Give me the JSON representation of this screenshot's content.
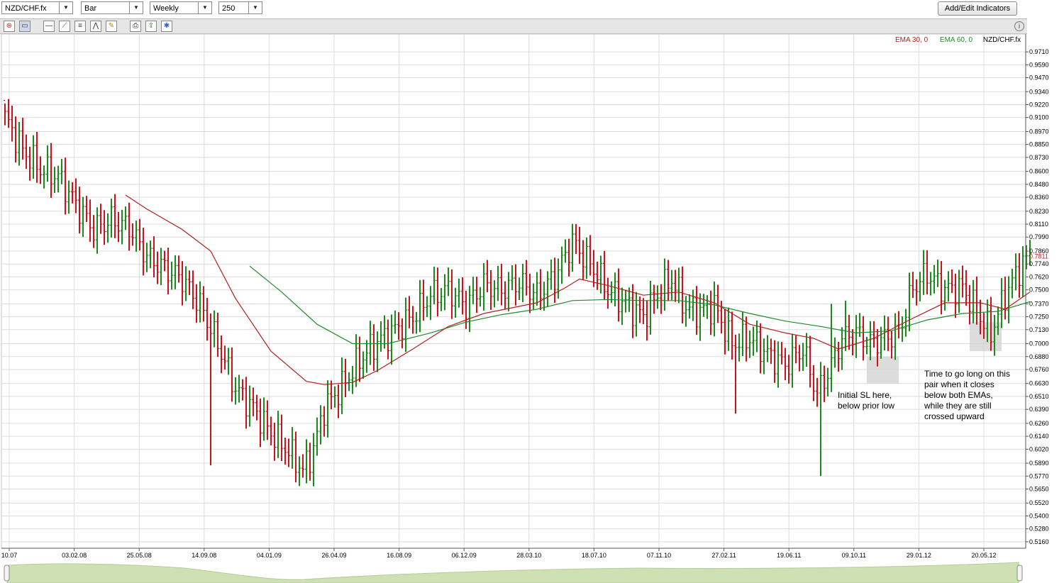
{
  "toolbar_top": {
    "symbol": "NZD/CHF.fx",
    "chart_type": "Bar",
    "period": "Weekly",
    "bars": "250",
    "add_indicators": "Add/Edit Indicators"
  },
  "toolbar_icons": [
    "crosshair-icon",
    "chart-style-icon",
    "horizontal-line-icon",
    "trend-line-icon",
    "fibonacci-icon",
    "pattern-icon",
    "eraser-icon",
    "print-icon",
    "export-icon",
    "settings-icon"
  ],
  "colors": {
    "up": "#1a8a1a",
    "down": "#d0101a",
    "ema30": "#b01e1e",
    "ema60": "#1f8a2a",
    "grid": "#dcdcdc"
  },
  "legend": {
    "ema30": "EMA 30, 0",
    "ema60": "EMA 60, 0",
    "symbol": "NZD/CHF.fx"
  },
  "annotations": {
    "sl": [
      "Initial SL here,",
      "below prior low"
    ],
    "entry": [
      "Time to go long on this",
      "pair when it closes",
      "below both EMAs,",
      "while they are still",
      "crossed upward"
    ]
  },
  "chart_data": {
    "type": "ohlc",
    "symbol": "NZD/CHF.fx",
    "timeframe": "Weekly",
    "current_price": "0.7811",
    "ylim": [
      0.51,
      0.977
    ],
    "y_ticks": [
      "0.9710",
      "0.9590",
      "0.9470",
      "0.9340",
      "0.9220",
      "0.9100",
      "0.8970",
      "0.8850",
      "0.8730",
      "0.8600",
      "0.8480",
      "0.8360",
      "0.8230",
      "0.8110",
      "0.7990",
      "0.7860",
      "0.7740",
      "0.7620",
      "0.7500",
      "0.7370",
      "0.7250",
      "0.7130",
      "0.7000",
      "0.6880",
      "0.6760",
      "0.6630",
      "0.6510",
      "0.6390",
      "0.6260",
      "0.6140",
      "0.6020",
      "0.5890",
      "0.5770",
      "0.5650",
      "0.5520",
      "0.5400",
      "0.5280",
      "0.5160"
    ],
    "x_ticks": [
      "10.07",
      "03.02.08",
      "25.05.08",
      "14.09.08",
      "04.01.09",
      "26.04.09",
      "16.08.09",
      "06.12.09",
      "28.03.10",
      "18.07.10",
      "07.11.10",
      "27.02.11",
      "19.06.11",
      "09.10.11",
      "29.01.12",
      "20.05.12"
    ],
    "anchor_closes": [
      [
        0,
        0.91
      ],
      [
        5,
        0.88
      ],
      [
        10,
        0.862
      ],
      [
        15,
        0.855
      ],
      [
        20,
        0.83
      ],
      [
        25,
        0.806
      ],
      [
        30,
        0.815
      ],
      [
        35,
        0.808
      ],
      [
        40,
        0.781
      ],
      [
        45,
        0.77
      ],
      [
        50,
        0.76
      ],
      [
        55,
        0.736
      ],
      [
        60,
        0.7
      ],
      [
        65,
        0.658
      ],
      [
        70,
        0.64
      ],
      [
        75,
        0.617
      ],
      [
        80,
        0.6
      ],
      [
        84,
        0.582
      ],
      [
        87,
        0.602
      ],
      [
        90,
        0.64
      ],
      [
        95,
        0.66
      ],
      [
        100,
        0.685
      ],
      [
        105,
        0.702
      ],
      [
        110,
        0.713
      ],
      [
        115,
        0.725
      ],
      [
        120,
        0.745
      ],
      [
        125,
        0.75
      ],
      [
        130,
        0.735
      ],
      [
        135,
        0.755
      ],
      [
        140,
        0.75
      ],
      [
        145,
        0.757
      ],
      [
        150,
        0.745
      ],
      [
        155,
        0.762
      ],
      [
        160,
        0.795
      ],
      [
        163,
        0.782
      ],
      [
        166,
        0.77
      ],
      [
        170,
        0.75
      ],
      [
        175,
        0.737
      ],
      [
        180,
        0.725
      ],
      [
        185,
        0.75
      ],
      [
        188,
        0.76
      ],
      [
        192,
        0.733
      ],
      [
        196,
        0.73
      ],
      [
        200,
        0.735
      ],
      [
        205,
        0.7
      ],
      [
        210,
        0.705
      ],
      [
        215,
        0.69
      ],
      [
        220,
        0.68
      ],
      [
        225,
        0.695
      ],
      [
        229,
        0.653
      ],
      [
        233,
        0.68
      ],
      [
        236,
        0.705
      ],
      [
        240,
        0.71
      ],
      [
        244,
        0.7
      ],
      [
        248,
        0.705
      ],
      [
        252,
        0.71
      ],
      [
        256,
        0.752
      ],
      [
        260,
        0.765
      ],
      [
        265,
        0.75
      ],
      [
        270,
        0.752
      ],
      [
        275,
        0.725
      ],
      [
        278,
        0.71
      ],
      [
        282,
        0.745
      ],
      [
        286,
        0.77
      ],
      [
        289,
        0.782
      ]
    ],
    "spikes": [
      [
        58,
        "low",
        0.587
      ],
      [
        206,
        "low",
        0.635
      ],
      [
        230,
        "low",
        0.577
      ],
      [
        233,
        "high",
        0.737
      ],
      [
        237,
        "high",
        0.74
      ],
      [
        247,
        "low",
        0.686
      ]
    ],
    "ema30": {
      "name": "EMA 30",
      "start_bar": 34,
      "points": [
        [
          34,
          0.838
        ],
        [
          40,
          0.825
        ],
        [
          50,
          0.806
        ],
        [
          58,
          0.786
        ],
        [
          65,
          0.742
        ],
        [
          75,
          0.693
        ],
        [
          85,
          0.665
        ],
        [
          90,
          0.662
        ],
        [
          98,
          0.664
        ],
        [
          105,
          0.675
        ],
        [
          115,
          0.695
        ],
        [
          125,
          0.716
        ],
        [
          135,
          0.728
        ],
        [
          150,
          0.738
        ],
        [
          158,
          0.752
        ],
        [
          162,
          0.76
        ],
        [
          170,
          0.754
        ],
        [
          180,
          0.745
        ],
        [
          190,
          0.748
        ],
        [
          200,
          0.738
        ],
        [
          210,
          0.718
        ],
        [
          220,
          0.71
        ],
        [
          228,
          0.705
        ],
        [
          235,
          0.695
        ],
        [
          245,
          0.705
        ],
        [
          255,
          0.722
        ],
        [
          265,
          0.738
        ],
        [
          275,
          0.738
        ],
        [
          282,
          0.732
        ],
        [
          289,
          0.748
        ]
      ]
    },
    "ema60": {
      "name": "EMA 60",
      "start_bar": 69,
      "points": [
        [
          69,
          0.772
        ],
        [
          78,
          0.748
        ],
        [
          88,
          0.718
        ],
        [
          98,
          0.7
        ],
        [
          108,
          0.7
        ],
        [
          120,
          0.71
        ],
        [
          130,
          0.72
        ],
        [
          140,
          0.727
        ],
        [
          150,
          0.732
        ],
        [
          160,
          0.74
        ],
        [
          170,
          0.741
        ],
        [
          180,
          0.74
        ],
        [
          190,
          0.74
        ],
        [
          200,
          0.736
        ],
        [
          210,
          0.728
        ],
        [
          220,
          0.721
        ],
        [
          230,
          0.716
        ],
        [
          240,
          0.71
        ],
        [
          250,
          0.712
        ],
        [
          260,
          0.722
        ],
        [
          270,
          0.728
        ],
        [
          280,
          0.73
        ],
        [
          289,
          0.739
        ]
      ]
    },
    "highlight_boxes": [
      {
        "from_bar": 243,
        "to_bar": 252,
        "ylim": [
          0.663,
          0.688
        ]
      },
      {
        "from_bar": 272,
        "to_bar": 281,
        "ylim": [
          0.693,
          0.72
        ]
      }
    ]
  }
}
